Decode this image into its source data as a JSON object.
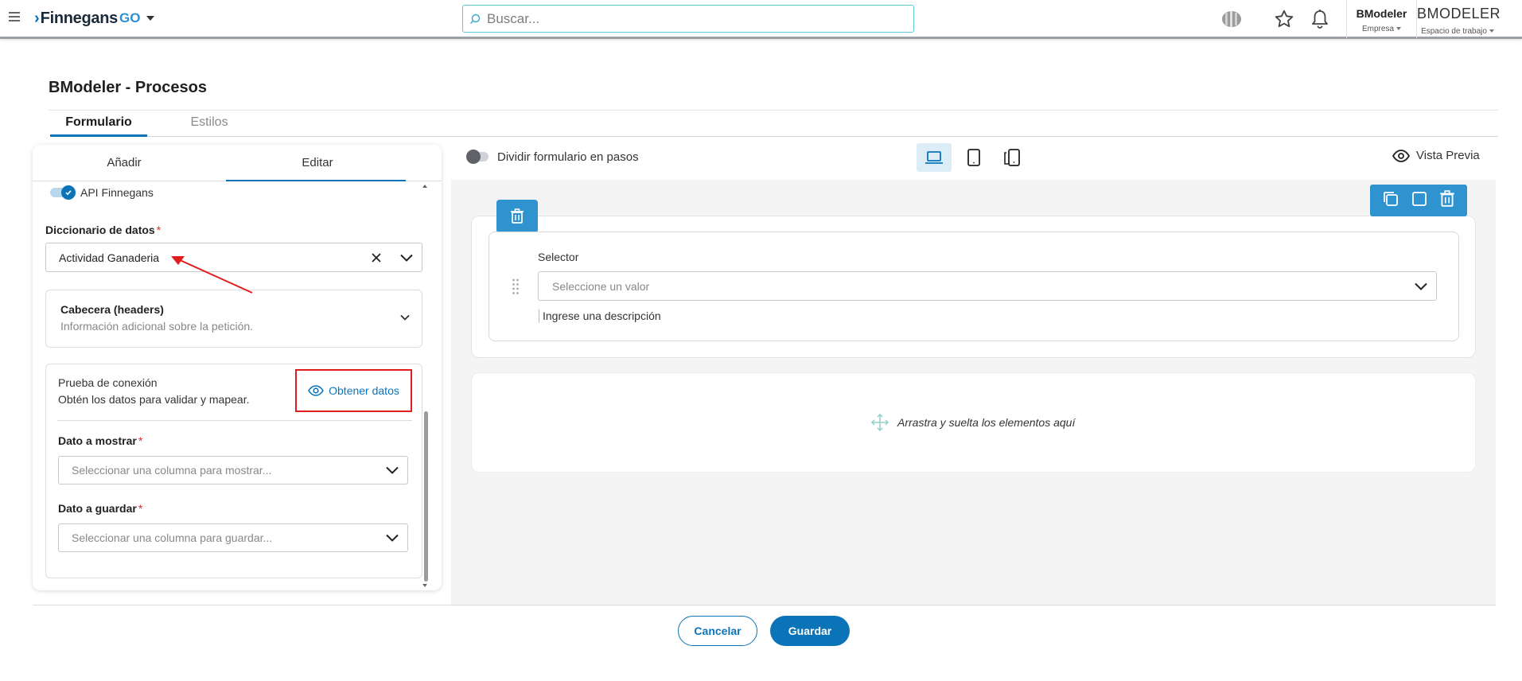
{
  "topbar": {
    "brand_name": "Finnegans",
    "brand_suffix": "GO",
    "search_placeholder": "Buscar...",
    "company": {
      "name": "BModeler",
      "label": "Empresa"
    },
    "workspace": {
      "name": "BMODELER",
      "label": "Espacio de trabajo"
    }
  },
  "page": {
    "title": "BModeler - Procesos",
    "tabs": [
      {
        "label": "Formulario",
        "active": true
      },
      {
        "label": "Estilos",
        "active": false
      }
    ]
  },
  "left_panel": {
    "tabs": [
      {
        "label": "Añadir",
        "active": false
      },
      {
        "label": "Editar",
        "active": true
      }
    ],
    "api_label": "API Finnegans",
    "dictionary": {
      "label": "Diccionario de datos",
      "value": "Actividad Ganaderia"
    },
    "headers": {
      "title": "Cabecera (headers)",
      "subtitle": "Información adicional sobre la petición."
    },
    "connection": {
      "title": "Prueba de conexión",
      "subtitle": "Obtén los datos para validar y mapear.",
      "button_label": "Obtener datos",
      "highlight_color": "#e11d1d"
    },
    "display_field": {
      "label": "Dato a mostrar",
      "placeholder": "Seleccionar una columna para mostrar..."
    },
    "save_field": {
      "label": "Dato a guardar",
      "placeholder": "Seleccionar una columna para guardar..."
    }
  },
  "canvas": {
    "split_label": "Dividir formulario en pasos",
    "preview_label": "Vista Previa",
    "selector": {
      "label": "Selector",
      "placeholder": "Seleccione un valor",
      "description": "Ingrese una descripción"
    },
    "drop_hint": "Arrastra y suelta los elementos aquí"
  },
  "footer": {
    "cancel_label": "Cancelar",
    "save_label": "Guardar"
  },
  "colors": {
    "primary": "#0b74b8",
    "accent_blue": "#2f93cf",
    "required": "#d32f2f"
  }
}
